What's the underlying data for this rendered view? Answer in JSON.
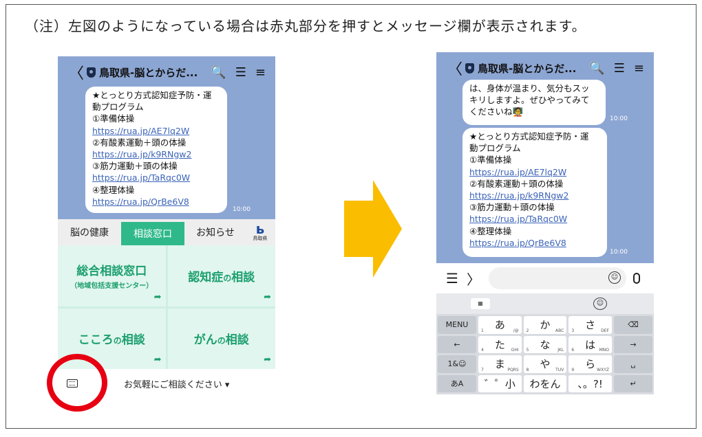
{
  "note": "（注）左図のようになっている場合は赤丸部分を押すとメッセージ欄が表示されます。",
  "header": {
    "back": "〈",
    "title": "鳥取県-脳とからだ...",
    "search_icon": "🔍",
    "notes_icon": "☰",
    "menu_icon": "≡"
  },
  "left": {
    "bubble": {
      "l1": "★とっとり方式認知症予防・運",
      "l2": "動プログラム",
      "l3": "①準備体操",
      "l4": "https://rua.jp/AE7lq2W",
      "l5": "②有酸素運動＋頭の体操",
      "l6": "https://rua.jp/k9RNgw2",
      "l7": "③筋力運動＋頭の体操",
      "l8": "https://rua.jp/TaRqc0W",
      "l9": "④整理体操",
      "l10": "https://rua.jp/QrBe6V8"
    },
    "time": "10:00",
    "tabs": [
      "脳の健康",
      "相談窓口",
      "お知らせ"
    ],
    "logo_glyph": "ь",
    "logo_text": "鳥取県",
    "cells": {
      "c1": "総合相談窓口",
      "c1_sub": "（地域包括支援センター）",
      "c2a": "認知症",
      "c2b": "の",
      "c2c": "相談",
      "c3a": "こころ",
      "c3b": "の",
      "c3c": "相談",
      "c4a": "がん",
      "c4b": "の",
      "c4c": "相談",
      "arrow": "➦"
    },
    "bottom_text": "お気軽にご相談ください ▾"
  },
  "right": {
    "b1": {
      "l1": "は、身体が温まり、気分もスッ",
      "l2": "キリしますよ。ぜひやってみて",
      "l3": "くださいね🧑‍🏫"
    },
    "b2": {
      "l1": "★とっとり方式認知症予防・運",
      "l2": "動プログラム",
      "l3": "①準備体操",
      "l4": "https://rua.jp/AE7lq2W",
      "l5": "②有酸素運動＋頭の体操",
      "l6": "https://rua.jp/k9RNgw2",
      "l7": "③筋力運動＋頭の体操",
      "l8": "https://rua.jp/TaRqc0W",
      "l9": "④整理体操",
      "l10": "https://rua.jp/QrBe6V8"
    },
    "time": "10:00",
    "input": {
      "menu": "☰",
      "chevron": "〉",
      "smile": "☺"
    },
    "keyboard": {
      "k_menu": "MENU",
      "k_left": "←",
      "k_sym": "1&☺",
      "k_mode": "あA",
      "r1": [
        "あ",
        "か",
        "さ"
      ],
      "r2": [
        "た",
        "な",
        "は"
      ],
      "r3": [
        "ま",
        "や",
        "ら"
      ],
      "r4": [
        "゛゜小",
        "わをん",
        "、。?!"
      ],
      "n1": [
        "1",
        "2",
        "3"
      ],
      "n2": [
        "4",
        "5",
        "6"
      ],
      "n3": [
        "7",
        "8",
        "9"
      ],
      "s1": [
        "/@",
        "ABC",
        "DEF"
      ],
      "s2": [
        "GHI",
        "JKL",
        "MNO"
      ],
      "s3": [
        "PQRS",
        "TUV",
        "WXYZ"
      ],
      "k_bs": "⌫",
      "k_right": "→",
      "k_space": "␣",
      "k_enter": "↵",
      "smile": "☺"
    }
  },
  "colors": {
    "chat_bg": "#8ca6d3",
    "accent_green": "#2fb98a",
    "red_circle": "#e60012",
    "arrow": "#fbbd00"
  }
}
